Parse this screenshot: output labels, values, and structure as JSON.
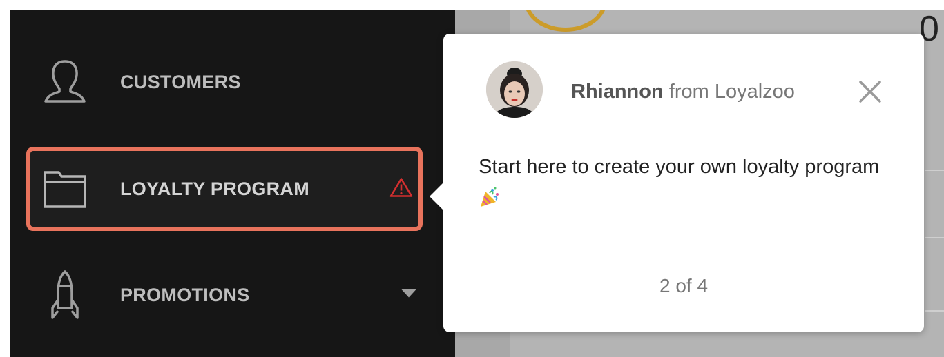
{
  "sidebar": {
    "items": [
      {
        "label": "CUSTOMERS",
        "icon": "user-outline-icon"
      },
      {
        "label": "LOYALTY PROGRAM",
        "icon": "folder-icon",
        "active": true,
        "badge": "warning-icon"
      },
      {
        "label": "PROMOTIONS",
        "icon": "rocket-icon",
        "trailing": "chevron-down-icon"
      }
    ],
    "highlight_color": "#e8735c",
    "warning_color": "#d32f2f"
  },
  "main": {
    "partial_value": "0"
  },
  "tour": {
    "sender_name": "Rhiannon",
    "sender_suffix": "from Loyalzoo",
    "message": "Start here to create your own loyalty program",
    "message_emoji": "party-popper-icon",
    "step_text": "2 of 4"
  }
}
